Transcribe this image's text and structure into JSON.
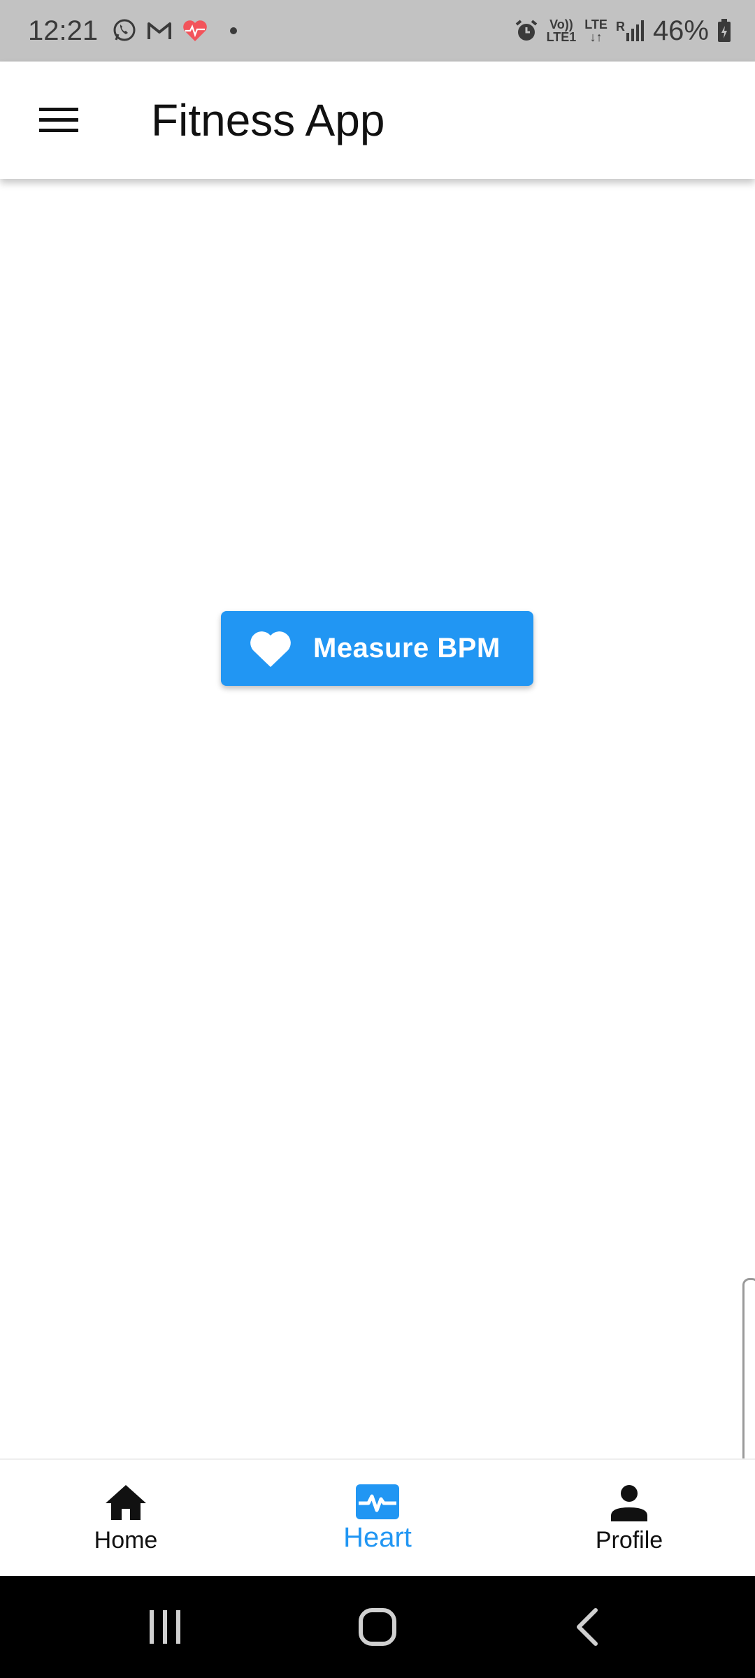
{
  "status_bar": {
    "time": "12:21",
    "battery": "46%",
    "volte_line1": "Vo))",
    "volte_line2": "LTE1",
    "network": "LTE",
    "roaming": "R",
    "notification_icons": [
      "whatsapp-icon",
      "gmail-icon",
      "health-heart-icon",
      "dot-icon"
    ],
    "system_icons": [
      "alarm-icon",
      "volte-icon",
      "lte-icon",
      "signal-icon",
      "battery-icon"
    ],
    "health_icon_color": "#f2545b"
  },
  "app_bar": {
    "title": "Fitness App",
    "menu_icon": "hamburger-menu-icon"
  },
  "main": {
    "measure_button": {
      "label": "Measure BPM",
      "icon": "heart-icon",
      "color": "#2196f3"
    }
  },
  "bottom_nav": {
    "accent": "#2196f3",
    "items": [
      {
        "label": "Home",
        "icon": "home-icon",
        "active": false
      },
      {
        "label": "Heart",
        "icon": "heart-pulse-icon",
        "active": true
      },
      {
        "label": "Profile",
        "icon": "person-icon",
        "active": false
      }
    ]
  },
  "system_nav": {
    "buttons": [
      "recents-icon",
      "home-circle-icon",
      "back-icon"
    ]
  }
}
